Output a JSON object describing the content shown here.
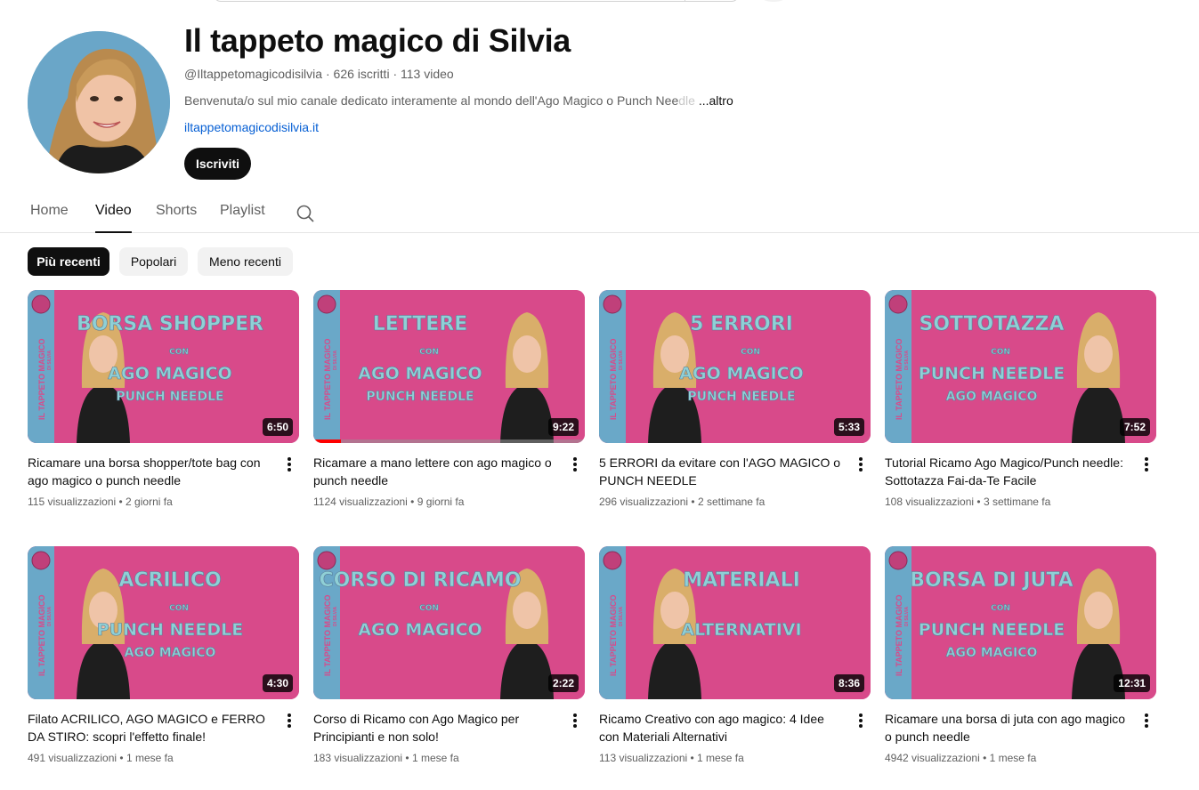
{
  "channel": {
    "title": "Il tappeto magico di Silvia",
    "handle": "@Iltappetomagicodisilvia",
    "subscribers": "626 iscritti",
    "video_count": "113 video",
    "description": "Benvenuta/o sul mio canale dedicato interamente al mondo dell'Ago Magico o Punch Nee",
    "description_fade": "dle",
    "description_more": "...altro",
    "link": "iltappetomagicodisilvia.it",
    "subscribe_label": "Iscriviti"
  },
  "tabs": [
    {
      "label": "Home",
      "active": false
    },
    {
      "label": "Video",
      "active": true
    },
    {
      "label": "Shorts",
      "active": false
    },
    {
      "label": "Playlist",
      "active": false
    }
  ],
  "chips": [
    {
      "label": "Più recenti",
      "active": true
    },
    {
      "label": "Popolari",
      "active": false
    },
    {
      "label": "Meno recenti",
      "active": false
    }
  ],
  "colors": {
    "thumb_pink": "#d84a8a",
    "thumb_band": "#6aa8c8",
    "thumb_text": "#8fd0d6",
    "progress_red": "#ff0000",
    "link_blue": "#065fd4"
  },
  "videos": [
    {
      "title": "Ricamare una borsa shopper/tote bag con ago magico o punch needle",
      "views": "115 visualizzazioni",
      "age": "2 giorni fa",
      "duration": "6:50",
      "thumb_text": [
        "BORSA SHOPPER",
        "CON",
        "AGO MAGICO",
        "PUNCH NEEDLE"
      ],
      "watched_fraction": 0
    },
    {
      "title": "Ricamare a mano lettere con ago magico o punch needle",
      "views": "1124 visualizzazioni",
      "age": "9 giorni fa",
      "duration": "9:22",
      "thumb_text": [
        "LETTERE",
        "CON",
        "AGO MAGICO",
        "PUNCH NEEDLE"
      ],
      "watched_fraction": 0.1
    },
    {
      "title": "5 ERRORI da evitare con l'AGO MAGICO o PUNCH NEEDLE",
      "views": "296 visualizzazioni",
      "age": "2 settimane fa",
      "duration": "5:33",
      "thumb_text": [
        "5 ERRORI",
        "CON",
        "AGO MAGICO",
        "PUNCH NEEDLE"
      ],
      "watched_fraction": 0
    },
    {
      "title": "Tutorial Ricamo Ago Magico/Punch needle: Sottotazza Fai-da-Te Facile",
      "views": "108 visualizzazioni",
      "age": "3 settimane fa",
      "duration": "7:52",
      "thumb_text": [
        "SOTTOTAZZA",
        "CON",
        "PUNCH NEEDLE",
        "AGO MAGICO"
      ],
      "watched_fraction": 0
    },
    {
      "title": "Filato ACRILICO, AGO MAGICO e FERRO DA STIRO: scopri l'effetto finale!",
      "views": "491 visualizzazioni",
      "age": "1 mese fa",
      "duration": "4:30",
      "thumb_text": [
        "ACRILICO",
        "CON",
        "PUNCH NEEDLE",
        "AGO MAGICO"
      ],
      "watched_fraction": 0
    },
    {
      "title": "Corso di Ricamo con Ago Magico per Principianti e non solo!",
      "views": "183 visualizzazioni",
      "age": "1 mese fa",
      "duration": "2:22",
      "thumb_text": [
        "CORSO DI RICAMO",
        "CON",
        "AGO MAGICO",
        ""
      ],
      "watched_fraction": 0
    },
    {
      "title": "Ricamo Creativo con ago magico: 4 Idee con Materiali Alternativi",
      "views": "113 visualizzazioni",
      "age": "1 mese fa",
      "duration": "8:36",
      "thumb_text": [
        "MATERIALI",
        "",
        "ALTERNATIVI",
        ""
      ],
      "watched_fraction": 0
    },
    {
      "title": "Ricamare una borsa di juta con ago magico o punch needle",
      "views": "4942 visualizzazioni",
      "age": "1 mese fa",
      "duration": "12:31",
      "thumb_text": [
        "BORSA DI JUTA",
        "CON",
        "PUNCH NEEDLE",
        "AGO MAGICO"
      ],
      "watched_fraction": 0
    }
  ],
  "thumb_band_text": [
    "IL TAPPETO MAGICO",
    "DI SILVIA"
  ]
}
